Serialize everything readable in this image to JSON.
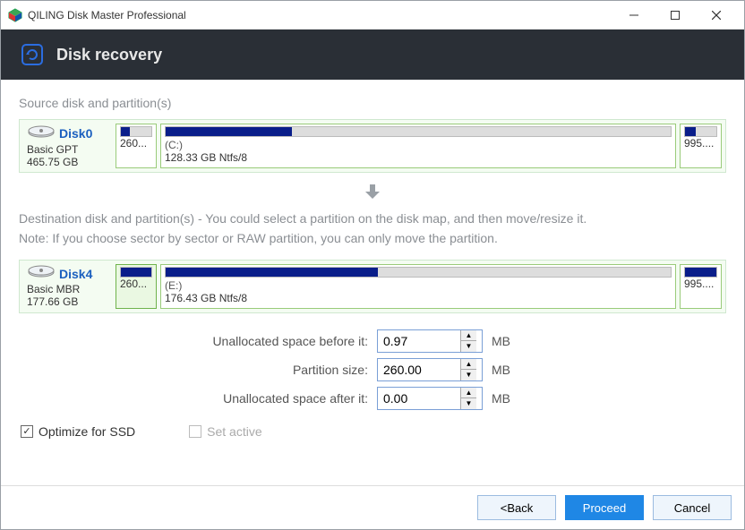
{
  "window": {
    "title": "QILING Disk Master Professional"
  },
  "header": {
    "title": "Disk recovery"
  },
  "source": {
    "label": "Source disk and partition(s)",
    "disk": {
      "name": "Disk0",
      "type": "Basic GPT",
      "size": "465.75 GB"
    },
    "parts": [
      {
        "bar_fill_pct": 30,
        "label": "",
        "sub": "260...",
        "selected": false
      },
      {
        "bar_fill_pct": 25,
        "label": "(C:)",
        "sub": "128.33 GB Ntfs/8",
        "selected": false
      },
      {
        "bar_fill_pct": 35,
        "label": "",
        "sub": "995....",
        "selected": false
      }
    ]
  },
  "arrow": "↓",
  "dest": {
    "hint1": "Destination disk and partition(s) - You could select a partition on the disk map, and then move/resize it.",
    "hint2": "Note: If you choose sector by sector or RAW partition, you can only move the partition.",
    "disk": {
      "name": "Disk4",
      "type": "Basic MBR",
      "size": "177.66 GB"
    },
    "parts": [
      {
        "bar_fill_pct": 100,
        "label": "",
        "sub": "260...",
        "selected": true
      },
      {
        "bar_fill_pct": 42,
        "label": "(E:)",
        "sub": "176.43 GB Ntfs/8",
        "selected": false
      },
      {
        "bar_fill_pct": 100,
        "label": "",
        "sub": "995....",
        "selected": false
      }
    ]
  },
  "form": {
    "before_label": "Unallocated space before it:",
    "before_value": "0.97",
    "size_label": "Partition size:",
    "size_value": "260.00",
    "after_label": "Unallocated space after it:",
    "after_value": "0.00",
    "unit": "MB"
  },
  "checks": {
    "ssd_label": "Optimize for SSD",
    "ssd_checked": true,
    "active_label": "Set active",
    "active_enabled": false
  },
  "footer": {
    "back": "<Back",
    "proceed": "Proceed",
    "cancel": "Cancel"
  }
}
